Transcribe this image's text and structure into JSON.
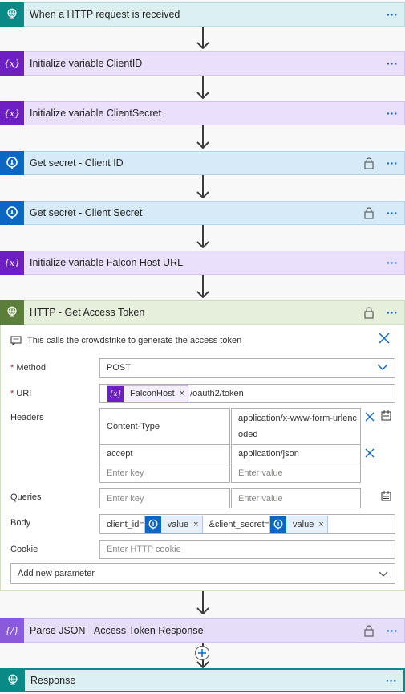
{
  "steps": [
    {
      "title": "When a HTTP request is received",
      "icon": "globe-icon"
    },
    {
      "title": "Initialize variable ClientID",
      "icon": "variable-icon"
    },
    {
      "title": "Initialize variable ClientSecret",
      "icon": "variable-icon"
    },
    {
      "title": "Get secret - Client ID",
      "icon": "key-vault-icon"
    },
    {
      "title": "Get secret - Client Secret",
      "icon": "key-vault-icon"
    },
    {
      "title": "Initialize variable Falcon Host URL",
      "icon": "variable-icon"
    },
    {
      "title": "HTTP - Get Access Token",
      "icon": "globe-icon"
    },
    {
      "title": "Parse JSON - Access Token Response",
      "icon": "parse-json-icon"
    },
    {
      "title": "Response",
      "icon": "globe-icon"
    }
  ],
  "more_label": "···",
  "http": {
    "comment": "This calls the crowdstrike to generate the access token",
    "method_label": "Method",
    "method_value": "POST",
    "uri_label": "URI",
    "uri_token": "FalconHost",
    "uri_suffix": "/oauth2/token",
    "headers_label": "Headers",
    "headers": [
      {
        "key": "Content-Type",
        "value_line1": "application/x-www-form-urlenc",
        "value_line2": "oded"
      },
      {
        "key": "accept",
        "value": "application/json"
      }
    ],
    "key_placeholder": "Enter key",
    "value_placeholder": "Enter value",
    "queries_label": "Queries",
    "body_label": "Body",
    "body_prefix": "client_id=",
    "body_token_value": "value",
    "body_mid": "&client_secret=",
    "cookie_label": "Cookie",
    "cookie_placeholder": "Enter HTTP cookie",
    "add_param_label": "Add new parameter"
  },
  "colors": {
    "teal": "#0a8a87",
    "purple": "#6d1fc4",
    "blue": "#0b67c2",
    "green": "#5b7f3b",
    "violet": "#8a5bd9"
  }
}
